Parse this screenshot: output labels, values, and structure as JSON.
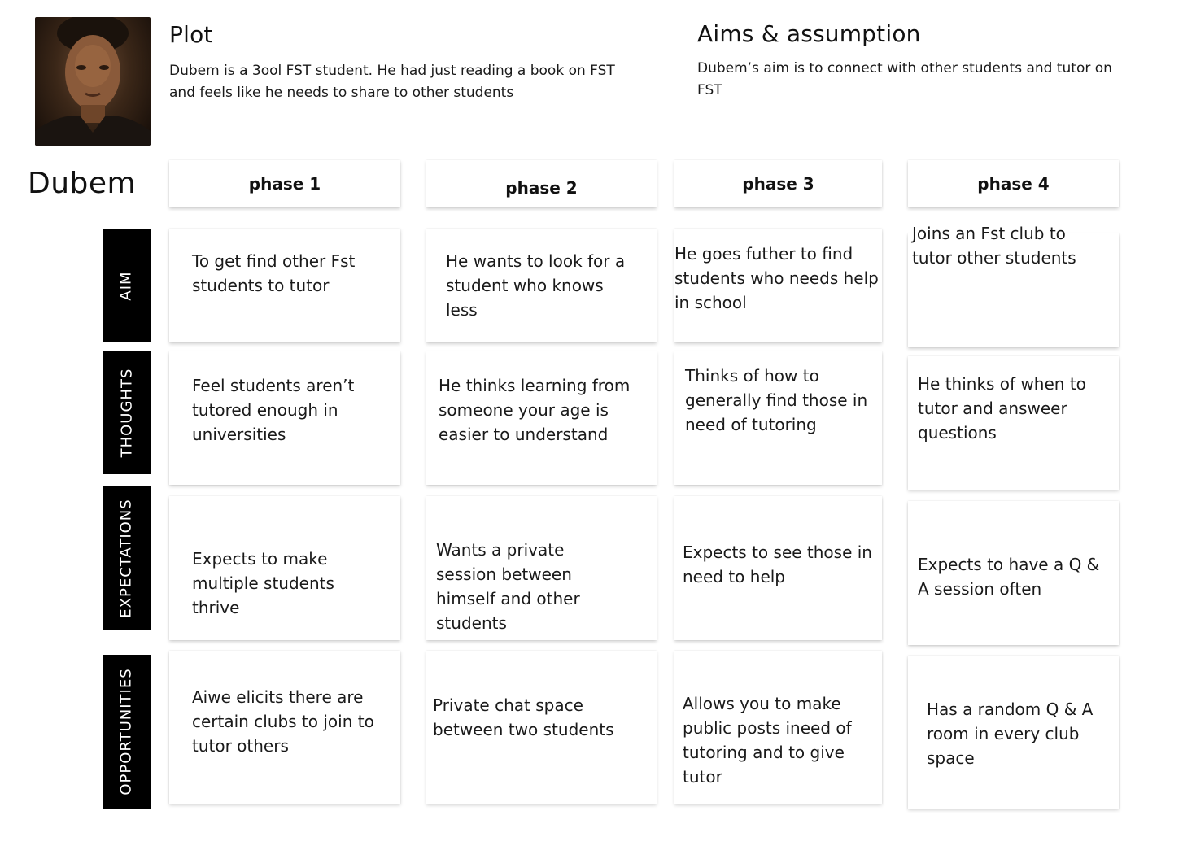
{
  "plot": {
    "title": "Plot",
    "text": "Dubem is a 3ool FST student. He had just reading a book on FST and feels like he needs to share to other students"
  },
  "aims": {
    "title": "Aims & assumption",
    "text": "Dubem’s aim is to connect with other students and tutor on FST"
  },
  "persona_name": "Dubem",
  "phases": [
    "phase 1",
    "phase 2",
    "phase 3",
    "phase 4"
  ],
  "rows": [
    {
      "label": "AIM",
      "cells": [
        "To get find other Fst students to tutor",
        "He wants to look for a student who knows less",
        "He goes futher to find students who needs help in school",
        "Joins an Fst club  to tutor other students"
      ]
    },
    {
      "label": "THOUGHTS",
      "cells": [
        "Feel students aren’t tutored enough in universities",
        "He thinks learning from someone your age is easier to understand",
        "Thinks of how to generally find those in need of tutoring",
        "He thinks of when to tutor and answeer questions"
      ]
    },
    {
      "label": "EXPECTATIONS",
      "cells": [
        "Expects to make multiple students thrive",
        "Wants a private session between himself and other students",
        "Expects to see those in need to help",
        "Expects to have a Q & A session often"
      ]
    },
    {
      "label": "OPPORTUNITIES",
      "cells": [
        "Aiwe elicits there are certain clubs to join to tutor others",
        "Private chat space between two students",
        "Allows you to make public posts ineed of tutoring and to give tutor",
        "Has a random Q & A room in every club space"
      ]
    }
  ]
}
